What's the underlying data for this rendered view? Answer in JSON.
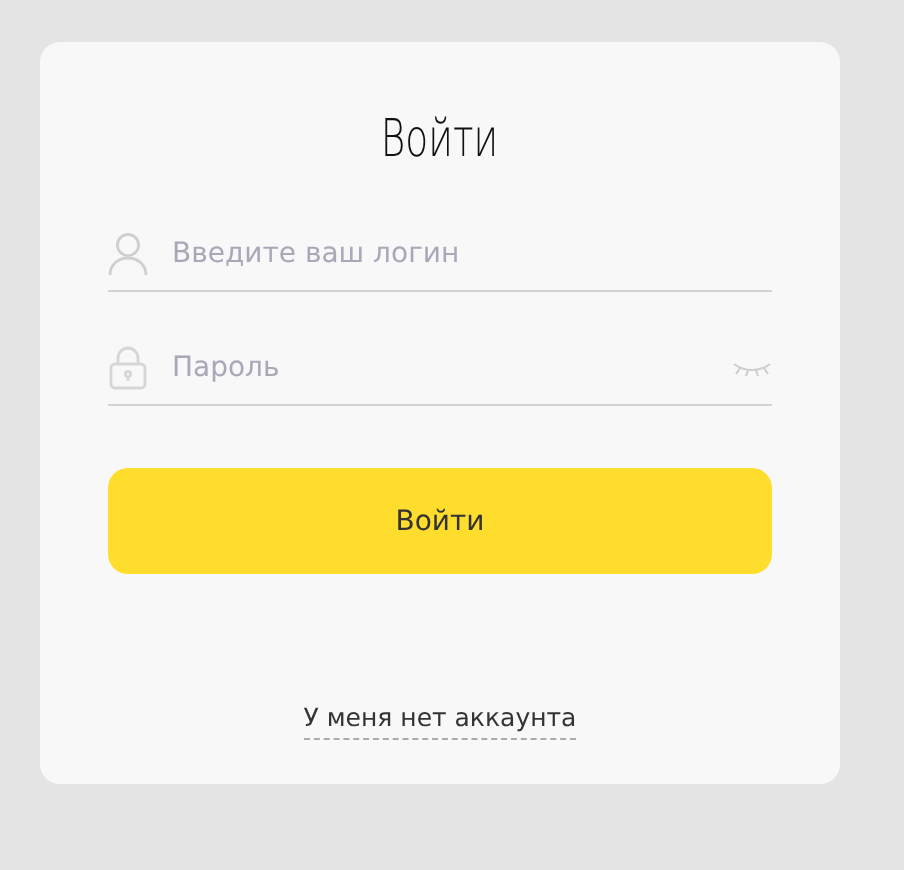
{
  "title": "Войти",
  "fields": [
    {
      "kind": "login",
      "placeholder": "Введите ваш логин"
    },
    {
      "kind": "password",
      "placeholder": "Пароль"
    }
  ],
  "submit": "Войти",
  "link": "У меня нет аккаунта"
}
